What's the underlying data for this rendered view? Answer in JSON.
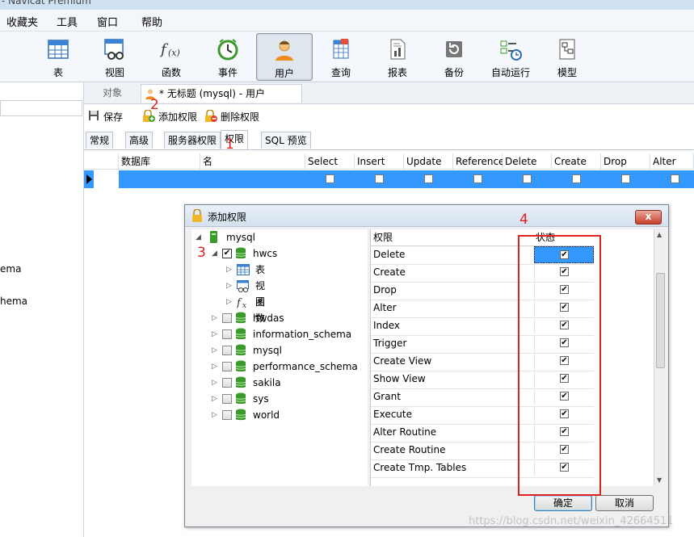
{
  "window": {
    "title": "- Navicat Premium"
  },
  "menu": [
    "收藏夹",
    "工具",
    "窗口",
    "帮助"
  ],
  "toolbar": {
    "buttons": [
      {
        "label": "表",
        "icon": "table-icon"
      },
      {
        "label": "视图",
        "icon": "view-icon"
      },
      {
        "label": "函数",
        "icon": "function-icon"
      },
      {
        "label": "事件",
        "icon": "event-clock-icon"
      },
      {
        "label": "用户",
        "icon": "user-icon",
        "active": true
      },
      {
        "label": "查询",
        "icon": "query-icon"
      },
      {
        "label": "报表",
        "icon": "report-icon"
      },
      {
        "label": "备份",
        "icon": "backup-icon"
      },
      {
        "label": "自动运行",
        "icon": "schedule-icon"
      },
      {
        "label": "模型",
        "icon": "model-icon"
      }
    ]
  },
  "left": {
    "rows": [
      "ema",
      "hema"
    ]
  },
  "tabs": {
    "objects": "对象",
    "current": "* 无标题 (mysql) - 用户"
  },
  "actions": {
    "save": "保存",
    "add_priv": "添加权限",
    "del_priv": "删除权限"
  },
  "subtabs": [
    "常规",
    "高级",
    "服务器权限",
    "权限",
    "SQL 预览"
  ],
  "grid": {
    "columns": [
      "数据库",
      "名",
      "Select",
      "Insert",
      "Update",
      "Reference",
      "Delete",
      "Create",
      "Drop",
      "Alter"
    ]
  },
  "annotations": [
    "1",
    "2",
    "3",
    "4"
  ],
  "dialog": {
    "title": "添加权限",
    "close": "x",
    "tree": {
      "root": "mysql",
      "selected_db": "hwcs",
      "children": [
        "表",
        "视图",
        "函数"
      ],
      "databases": [
        "hwdas",
        "information_schema",
        "mysql",
        "performance_schema",
        "sakila",
        "sys",
        "world"
      ]
    },
    "privileges_header": "权限",
    "status_header": "状态",
    "privileges": [
      "Delete",
      "Create",
      "Drop",
      "Alter",
      "Index",
      "Trigger",
      "Create View",
      "Show View",
      "Grant",
      "Execute",
      "Alter Routine",
      "Create Routine",
      "Create Tmp. Tables"
    ],
    "ok": "确定",
    "cancel": "取消"
  },
  "watermark": "https://blog.csdn.net/weixin_42664511",
  "colors": {
    "accent": "#3399ff",
    "annotation": "#e12020"
  }
}
